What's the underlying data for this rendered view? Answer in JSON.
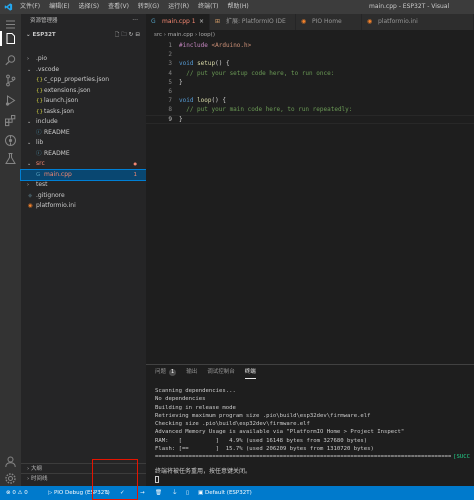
{
  "window": {
    "title": "main.cpp - ESP32T - Visual"
  },
  "menu": [
    "文件(F)",
    "编辑(E)",
    "选择(S)",
    "查看(V)",
    "转到(G)",
    "运行(R)",
    "终端(T)",
    "帮助(H)"
  ],
  "activity_icons": [
    "files-icon",
    "search-icon",
    "source-control-icon",
    "run-debug-icon",
    "extensions-icon",
    "platformio-icon",
    "test-icon",
    "account-icon",
    "settings-gear-icon"
  ],
  "sidebar": {
    "header": "资源管理器",
    "header_more": "···",
    "project": "ESP32T",
    "tree": [
      {
        "label": ".pio",
        "depth": 1,
        "kind": "folder",
        "open": false
      },
      {
        "label": ".vscode",
        "depth": 1,
        "kind": "folder",
        "open": true
      },
      {
        "label": "c_cpp_properties.json",
        "depth": 2,
        "kind": "json"
      },
      {
        "label": "extensions.json",
        "depth": 2,
        "kind": "json"
      },
      {
        "label": "launch.json",
        "depth": 2,
        "kind": "json"
      },
      {
        "label": "tasks.json",
        "depth": 2,
        "kind": "json"
      },
      {
        "label": "include",
        "depth": 1,
        "kind": "folder",
        "open": true
      },
      {
        "label": "README",
        "depth": 2,
        "kind": "info"
      },
      {
        "label": "lib",
        "depth": 1,
        "kind": "folder",
        "open": true
      },
      {
        "label": "README",
        "depth": 2,
        "kind": "info"
      },
      {
        "label": "src",
        "depth": 1,
        "kind": "folder",
        "open": true,
        "error": true
      },
      {
        "label": "main.cpp",
        "depth": 2,
        "kind": "cpp",
        "error": true,
        "selected": true,
        "badge": "1"
      },
      {
        "label": "test",
        "depth": 1,
        "kind": "folder",
        "open": false
      },
      {
        "label": ".gitignore",
        "depth": 1,
        "kind": "git"
      },
      {
        "label": "platformio.ini",
        "depth": 1,
        "kind": "pio"
      }
    ],
    "outline_label": "大纲",
    "timeline_label": "时间线"
  },
  "tabs": [
    {
      "label": "main.cpp 1",
      "icon": "cpp",
      "active": true,
      "close": "×"
    },
    {
      "label": "扩展: PlatformIO IDE",
      "icon": "ext",
      "active": false,
      "close": ""
    },
    {
      "label": "PIO Home",
      "icon": "pio",
      "active": false,
      "close": ""
    },
    {
      "label": "platformio.ini",
      "icon": "pio",
      "active": false,
      "close": ""
    }
  ],
  "breadcrumb": "src  ›  main.cpp  ›  loop()",
  "editor": {
    "line_numbers": [
      "1",
      "2",
      "3",
      "4",
      "5",
      "6",
      "7",
      "8",
      "9"
    ],
    "current_line": 9
  },
  "panel": {
    "tabs": [
      "问题",
      "输出",
      "调试控制台",
      "终端"
    ],
    "problems_badge": "1",
    "terminal_lines": [
      "Scanning dependencies...",
      "No dependencies",
      "Building in release mode",
      "Retrieving maximum program size .pio\\build\\esp32dev\\firmware.elf",
      "Checking size .pio\\build\\esp32dev\\firmware.elf",
      "Advanced Memory Usage is available via \"PlatformIO Home > Project Inspect\"",
      "RAM:   [          ]   4.9% (used 16148 bytes from 327680 bytes)",
      "Flash: [==        ]  15.7% (used 206209 bytes from 1310720 bytes)"
    ],
    "success_marker": "[SUCC",
    "terminal_message": "终端将被任务重用，按任意键关闭。"
  },
  "statusbar": {
    "errors": "⊗ 0 ⚠ 0",
    "debug": "PIO Debug (ESP32T)",
    "home": "⌂",
    "build": "✓",
    "upload": "→",
    "clean": "🗑",
    "serial": "⏚",
    "terminal": "▯",
    "env": "Default (ESP32T)"
  },
  "colors": {
    "accent": "#007acc",
    "error": "#f48771",
    "highlight_box": "#e51400"
  }
}
